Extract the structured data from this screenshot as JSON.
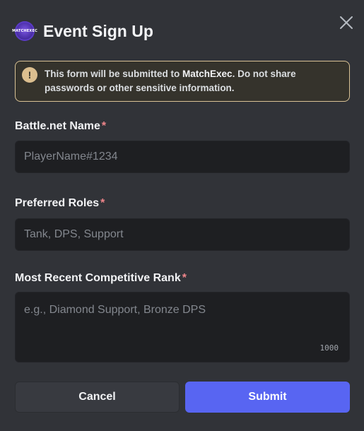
{
  "modal": {
    "title": "Event Sign Up",
    "app_icon_text": "MATCHEXEC"
  },
  "warning": {
    "text_before": "This form will be submitted to ",
    "app_name": "MatchExec",
    "text_after": ". Do not share passwords or other sensitive information.",
    "icon": "!"
  },
  "fields": [
    {
      "label": "Battle.net Name",
      "required_mark": "*",
      "placeholder": "PlayerName#1234"
    },
    {
      "label": "Preferred Roles",
      "required_mark": "*",
      "placeholder": "Tank, DPS, Support"
    },
    {
      "label": "Most Recent Competitive Rank",
      "required_mark": "*",
      "placeholder": "e.g., Diamond Support, Bronze DPS",
      "char_limit": "1000"
    }
  ],
  "buttons": {
    "cancel": "Cancel",
    "submit": "Submit"
  },
  "colors": {
    "background": "#313338",
    "input_bg": "#1e1f22",
    "warning_border": "#d9c295",
    "required": "#f0868b",
    "primary": "#5865f2"
  }
}
